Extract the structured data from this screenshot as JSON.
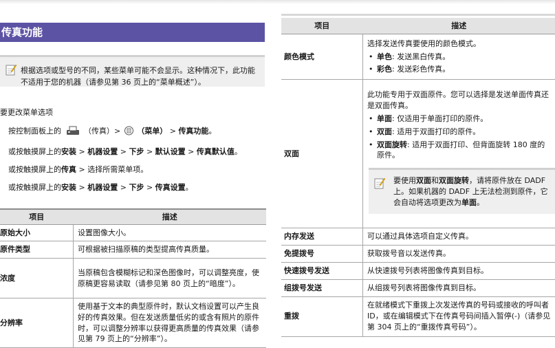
{
  "left": {
    "section_title": "传真功能",
    "note": "根据选项或型号的不同，某些菜单可能不会显示。这种情况下，此功能不适用于您的机器（请参见第 36 页上的“菜单概述”）。",
    "menu_heading": "要更改菜单选项",
    "step1": {
      "prefix": "按控制面板上的",
      "fax_label": "（传真）>",
      "menu_label": "（菜单）",
      "sep": ">",
      "target": "传真功能",
      "end": "。"
    },
    "step2": {
      "prefix": "或按触摸屏上的",
      "p1": "安装",
      "p2": "机器设置",
      "p3": "下步",
      "p4": "默认设置",
      "p5": "传真默认值",
      "sep": ">",
      "end": "。"
    },
    "step3": {
      "prefix": "或按触摸屏上的",
      "p1": "传真",
      "rest": "> 选择所需菜单项。"
    },
    "step4": {
      "prefix": "或按触摸屏上的",
      "p1": "安装",
      "p2": "机器设置",
      "p3": "下步",
      "p4": "传真设置",
      "sep": ">",
      "end": "。"
    },
    "table": {
      "headers": [
        "项目",
        "描述"
      ],
      "rows": [
        {
          "item": "原始大小",
          "desc": "设置图像大小。"
        },
        {
          "item": "原件类型",
          "desc": "可根据被扫描原稿的类型提高传真质量。"
        },
        {
          "item": "浓度",
          "desc": "当原稿包含模糊标记和深色图像时，可以调整亮度，使原稿更容易读取（请参见第 80 页上的“暗度”）。"
        },
        {
          "item": "分辨率",
          "desc": "使用基于文本的典型原件时，默认文档设置可以产生良好的传真效果。但在发送质量低劣的或含有照片的原件时，可以调整分辨率以获得更高质量的传真效果（请参见第 79 页上的“分辨率”）。"
        }
      ]
    }
  },
  "right": {
    "table": {
      "headers": [
        "项目",
        "描述"
      ],
      "color_mode": {
        "item": "颜色模式",
        "desc": "选择发送传真要使用的颜色模式。",
        "b1_label": "单色",
        "b1_text": ": 发送黑白传真。",
        "b2_label": "彩色",
        "b2_text": ": 发送彩色传真。"
      },
      "duplex": {
        "item": "双面",
        "desc": "此功能专用于双面原件。您可以选择是发送单面传真还是双面传真。",
        "b1_label": "单面",
        "b1_text": ": 仅适用于单面打印的原件。",
        "b2_label": "双面",
        "b2_text": ": 适用于双面打印的原件。",
        "b3_label": "双面旋转",
        "b3_text": ": 适用于双面打印、但背面旋转 180 度的原件。",
        "note_prefix": "要使用",
        "note_b1": "双面",
        "note_mid": "和",
        "note_b2": "双面旋转",
        "note_text": "，请将原件放在 DADF 上。如果机器的 DADF 上无法检测到原件，它会自动将选项更改为",
        "note_b3": "单面",
        "note_end": "。"
      },
      "rows": [
        {
          "item": "内存发送",
          "desc": "可以通过具体选项自定义传真。"
        },
        {
          "item": "免提拨号",
          "desc": "获取拨号音以发送传真。"
        },
        {
          "item": "快速拨号发送",
          "desc": "从快速拨号列表将图像传真到目标。"
        },
        {
          "item": "组拨号发送",
          "desc": "从组拨号列表将图像传真到目标。"
        },
        {
          "item": "重拨",
          "desc": "在就绪模式下重拨上次发送传真的号码或接收的呼叫者 ID，或在编辑模式下在传真号码间插入暂停(-)（请参见第 304 页上的“重拨传真号码”）。"
        }
      ]
    }
  }
}
